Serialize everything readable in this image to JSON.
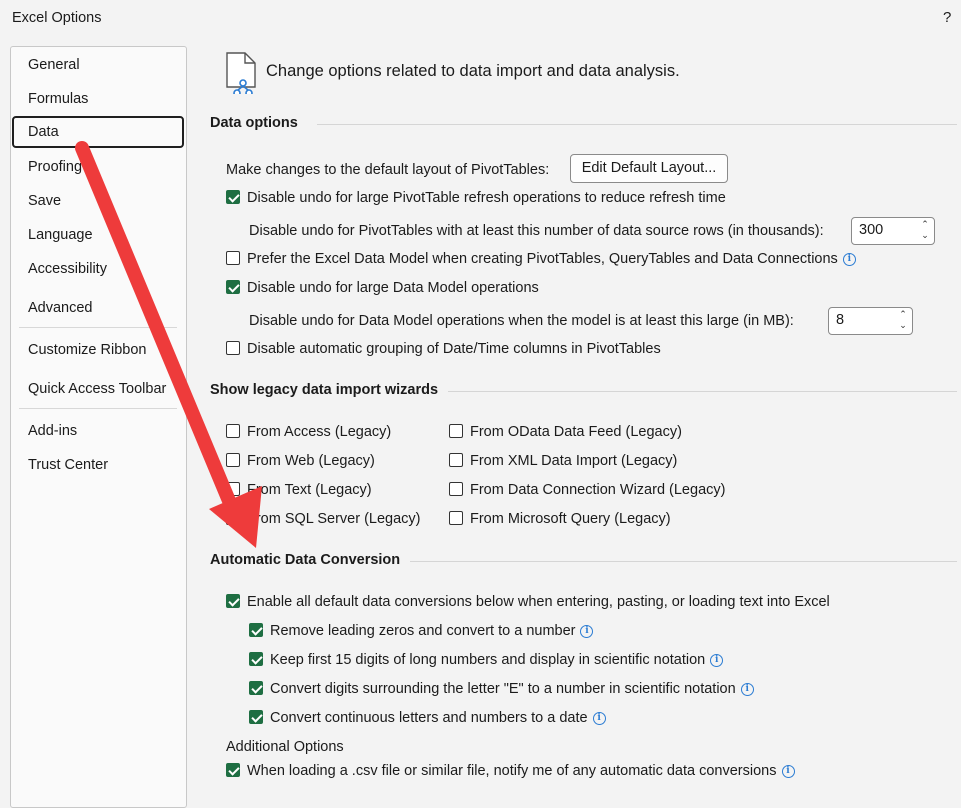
{
  "window": {
    "title": "Excel Options",
    "help": "?"
  },
  "nav": {
    "items": [
      {
        "label": "General"
      },
      {
        "label": "Formulas"
      },
      {
        "label": "Data"
      },
      {
        "label": "Proofing"
      },
      {
        "label": "Save"
      },
      {
        "label": "Language"
      },
      {
        "label": "Accessibility"
      },
      {
        "label": "Advanced"
      },
      {
        "label": "Customize Ribbon"
      },
      {
        "label": "Quick Access Toolbar"
      },
      {
        "label": "Add-ins"
      },
      {
        "label": "Trust Center"
      }
    ],
    "selected": "Data"
  },
  "header": {
    "text": "Change options related to data import and data analysis.",
    "icon": "data-document-icon"
  },
  "data_options": {
    "title": "Data options",
    "pivot_layout_label": "Make changes to the default layout of PivotTables:",
    "edit_layout_button": "Edit Default Layout...",
    "disable_undo_pivot": {
      "label": "Disable undo for large PivotTable refresh operations to reduce refresh time",
      "checked": true
    },
    "pivot_rows_label": "Disable undo for PivotTables with at least this number of data source rows (in thousands):",
    "pivot_rows_value": "300",
    "prefer_data_model": {
      "label": "Prefer the Excel Data Model when creating PivotTables, QueryTables and Data Connections",
      "checked": false
    },
    "disable_undo_model": {
      "label": "Disable undo for large Data Model operations",
      "checked": true
    },
    "model_size_label": "Disable undo for Data Model operations when the model is at least this large (in MB):",
    "model_size_value": "8",
    "disable_grouping": {
      "label": "Disable automatic grouping of Date/Time columns in PivotTables",
      "checked": false
    }
  },
  "legacy": {
    "title": "Show legacy data import wizards",
    "left": [
      {
        "label": "From Access (Legacy)",
        "checked": false
      },
      {
        "label": "From Web (Legacy)",
        "checked": false
      },
      {
        "label": "From Text (Legacy)",
        "checked": false
      },
      {
        "label": "From SQL Server (Legacy)",
        "checked": false
      }
    ],
    "right": [
      {
        "label": "From OData Data Feed (Legacy)",
        "checked": false
      },
      {
        "label": "From XML Data Import (Legacy)",
        "checked": false
      },
      {
        "label": "From Data Connection Wizard (Legacy)",
        "checked": false
      },
      {
        "label": "From Microsoft Query (Legacy)",
        "checked": false
      }
    ]
  },
  "conversion": {
    "title": "Automatic Data Conversion",
    "enable_all": {
      "label": "Enable all default data conversions below when entering, pasting, or loading text into Excel",
      "checked": true
    },
    "options": [
      {
        "label": "Remove leading zeros and convert to a number",
        "checked": true
      },
      {
        "label": "Keep first 15 digits of long numbers and display in scientific notation",
        "checked": true
      },
      {
        "label": "Convert digits surrounding the letter \"E\" to a number in scientific notation",
        "checked": true
      },
      {
        "label": "Convert continuous letters and numbers to a date",
        "checked": true
      }
    ],
    "additional_title": "Additional Options",
    "csv_notify": {
      "label": "When loading a .csv file or similar file, notify me of any automatic data conversions",
      "checked": true
    }
  },
  "colors": {
    "checkbox": "#1e6e42",
    "annotation_arrow": "#ee3b3b",
    "info_icon": "#2b7cd3"
  }
}
